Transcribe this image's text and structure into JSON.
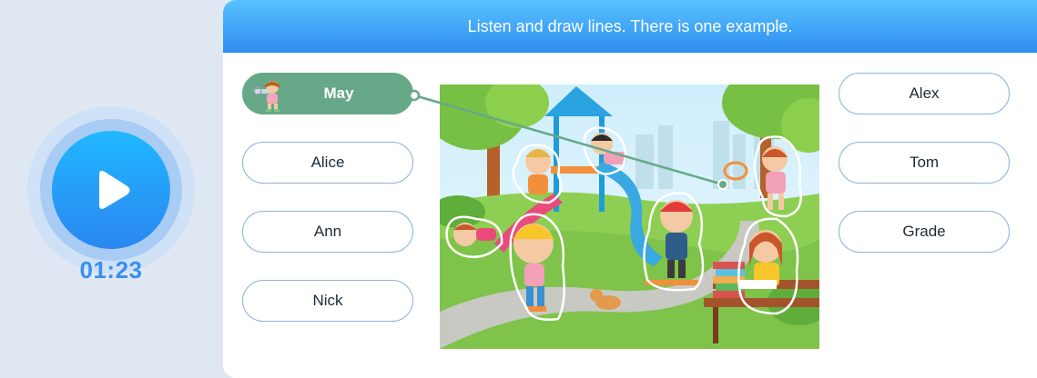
{
  "audio": {
    "timer": "01:23",
    "play_icon": "play-icon"
  },
  "header": {
    "instruction": "Listen and draw lines. There is one example."
  },
  "left_names": [
    {
      "label": "May",
      "selected": true
    },
    {
      "label": "Alice",
      "selected": false
    },
    {
      "label": "Ann",
      "selected": false
    },
    {
      "label": "Nick",
      "selected": false
    }
  ],
  "right_names": [
    {
      "label": "Alex"
    },
    {
      "label": "Tom"
    },
    {
      "label": "Grade"
    }
  ],
  "example_link": {
    "from": "May",
    "to": "girl-with-racket"
  },
  "colors": {
    "header_start": "#57c3ff",
    "header_end": "#2f8cf0",
    "selected_button": "#66a887",
    "button_border": "#8fb3d8",
    "play_button": "#2a86f0",
    "timer": "#3a8ff0"
  }
}
